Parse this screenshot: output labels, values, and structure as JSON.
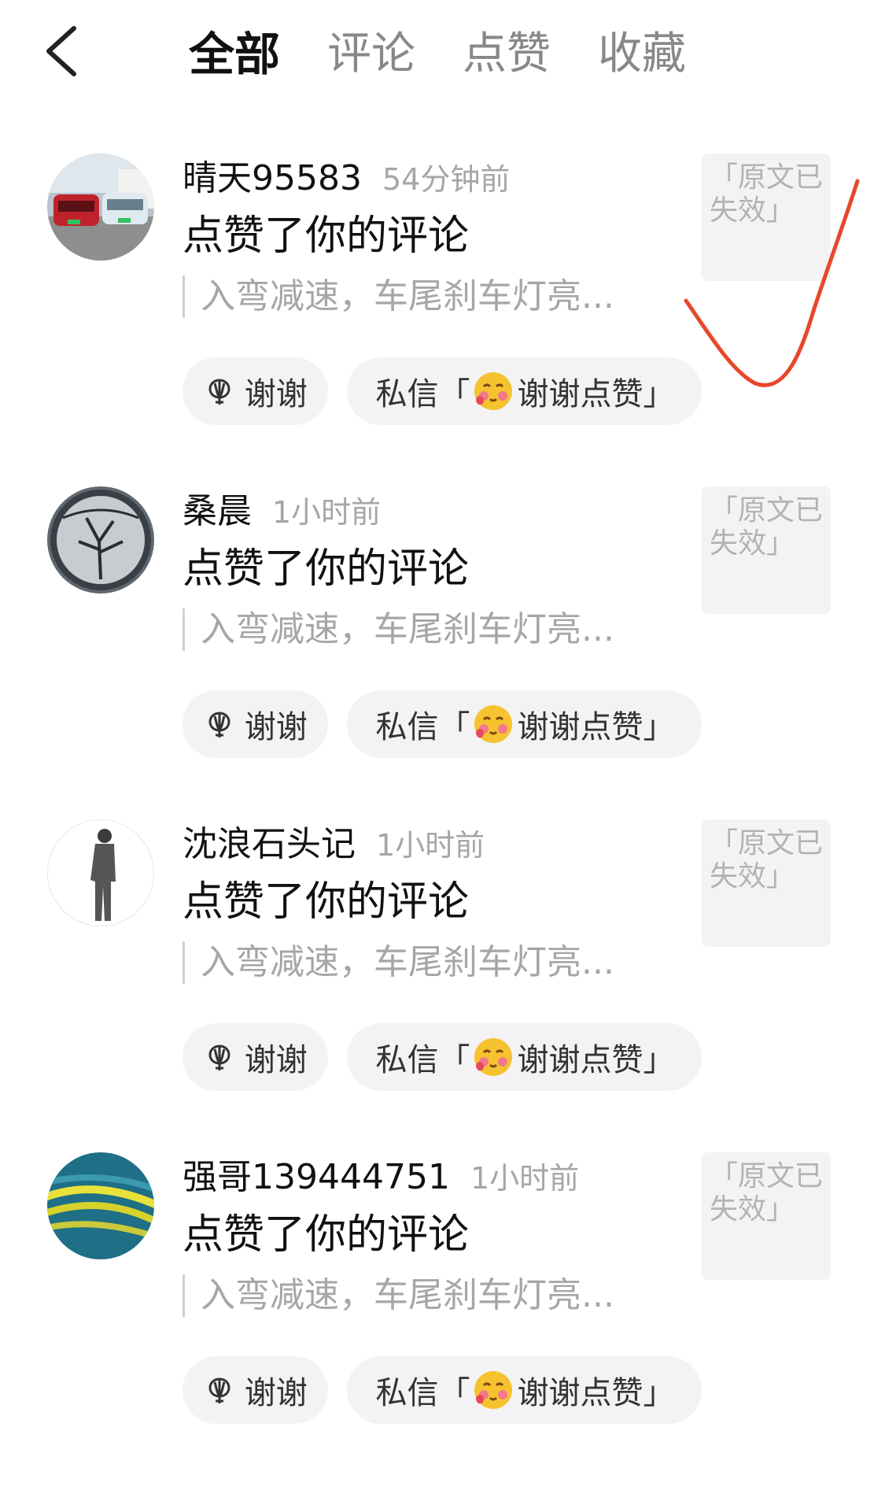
{
  "header": {
    "tabs": [
      {
        "label": "全部",
        "active": true
      },
      {
        "label": "评论",
        "active": false
      },
      {
        "label": "点赞",
        "active": false
      },
      {
        "label": "收藏",
        "active": false
      }
    ]
  },
  "items": [
    {
      "username": "晴天95583",
      "time": "54分钟前",
      "action": "点赞了你的评论",
      "quote": "入弯减速，车尾刹车灯亮...",
      "thanks_label": "谢谢",
      "dm_prefix": "私信「",
      "dm_suffix": "谢谢点赞」",
      "original": "「原文已失效」"
    },
    {
      "username": "桑晨",
      "time": "1小时前",
      "action": "点赞了你的评论",
      "quote": "入弯减速，车尾刹车灯亮...",
      "thanks_label": "谢谢",
      "dm_prefix": "私信「",
      "dm_suffix": "谢谢点赞」",
      "original": "「原文已失效」"
    },
    {
      "username": "沈浪石头记",
      "time": "1小时前",
      "action": "点赞了你的评论",
      "quote": "入弯减速，车尾刹车灯亮...",
      "thanks_label": "谢谢",
      "dm_prefix": "私信「",
      "dm_suffix": "谢谢点赞」",
      "original": "「原文已失效」"
    },
    {
      "username": "强哥139444751",
      "time": "1小时前",
      "action": "点赞了你的评论",
      "quote": "入弯减速，车尾刹车灯亮...",
      "thanks_label": "谢谢",
      "dm_prefix": "私信「",
      "dm_suffix": "谢谢点赞」",
      "original": "「原文已失效」"
    }
  ],
  "colors": {
    "annotation_mark": "#e8472b",
    "button_bg": "#f3f3f3",
    "muted_text": "#a6a6a6"
  },
  "icons": [
    "back-arrow-icon",
    "thanks-flower-icon",
    "blush-emoji-icon"
  ]
}
